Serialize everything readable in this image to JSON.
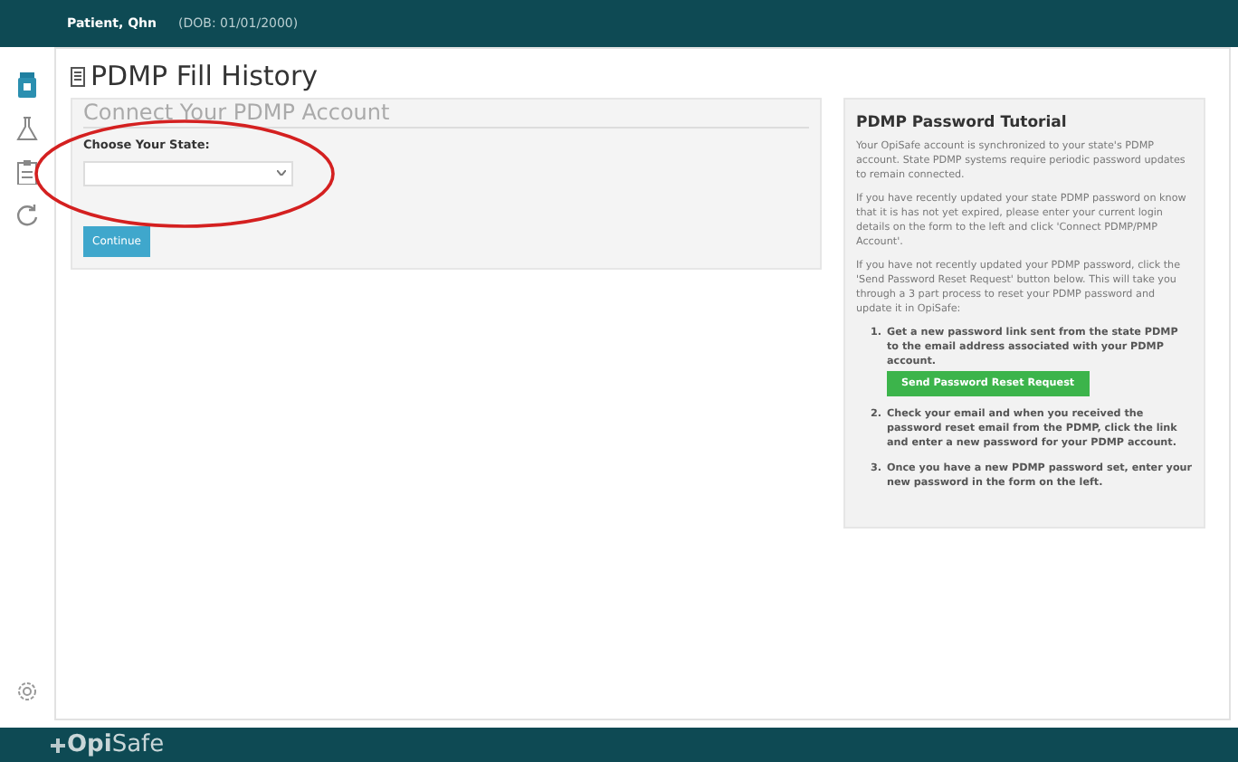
{
  "header": {
    "patient": "Patient, Qhn",
    "dob": "(DOB: 01/01/2000)"
  },
  "page_title": "PDMP Fill History",
  "connect_form": {
    "heading": "Connect Your PDMP Account",
    "state_label": "Choose Your State:",
    "continue_button": "Continue"
  },
  "tutorial": {
    "title": "PDMP Password Tutorial",
    "paragraphs": [
      "Your OpiSafe account is synchronized to your state's PDMP account. State PDMP systems require periodic password updates to remain connected.",
      "If you have recently updated your state PDMP password on know that it is has not yet expired, please enter your current login details on the form to the left and click 'Connect PDMP/PMP Account'.",
      "If you have not recently updated your PDMP password, click the 'Send Password Reset Request' button below. This will take you through a 3 part process to reset your PDMP password and update it in OpiSafe:"
    ],
    "steps": [
      {
        "number": "1.",
        "text": "Get a new password link sent from the state PDMP to the email address associated with your PDMP account.",
        "button": "Send Password Reset Request"
      },
      {
        "number": "2.",
        "text": "Check your email and when you received the password reset email from the PDMP, click the link and enter a new password for your PDMP account."
      },
      {
        "number": "3.",
        "text": "Once you have a new PDMP password set, enter your new password in the form on the left."
      }
    ]
  },
  "footer": {
    "logo": "**Opi**Safe"
  }
}
